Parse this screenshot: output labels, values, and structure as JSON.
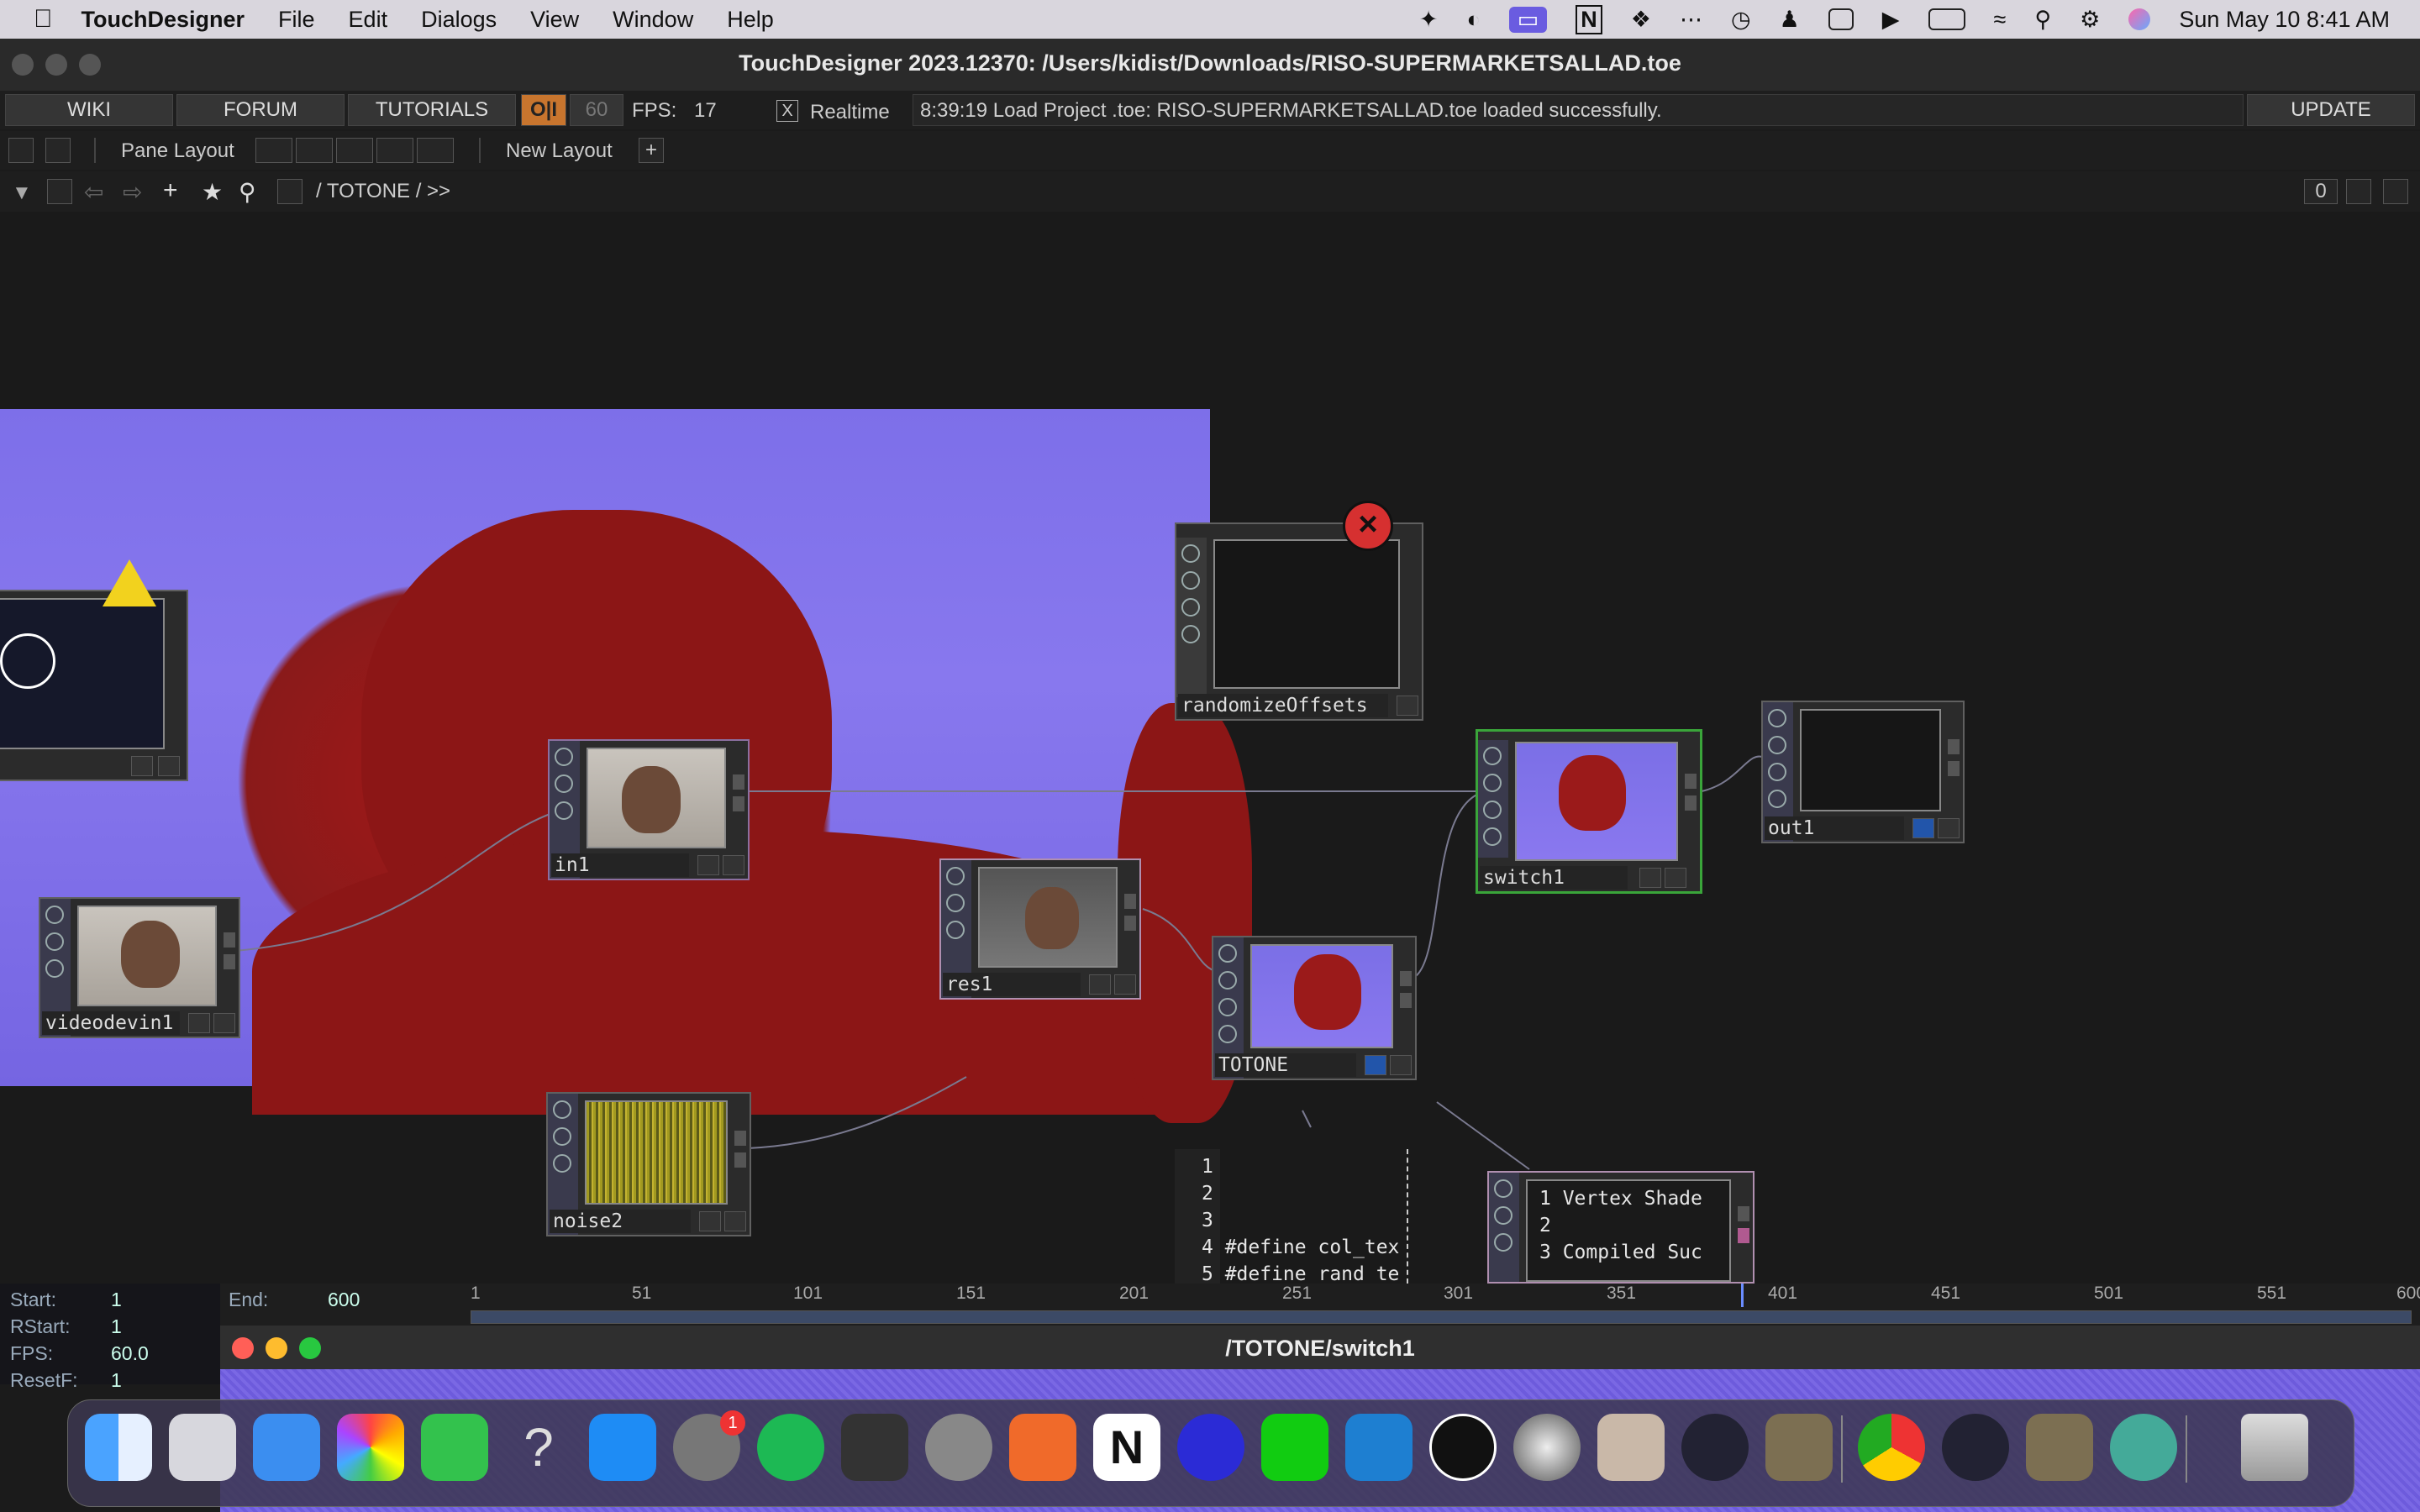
{
  "menubar": {
    "app": "TouchDesigner",
    "items": [
      "File",
      "Edit",
      "Dialogs",
      "View",
      "Window",
      "Help"
    ],
    "datetime": "Sun May 10  8:41 AM",
    "status_icons": [
      "sparkle-icon",
      "browser-icon",
      "screen-mirror-icon",
      "notion-icon",
      "dropbox-icon",
      "more-icon",
      "clock-icon",
      "accessibility-icon",
      "caption-icon",
      "play-icon",
      "battery-icon",
      "wifi-icon",
      "search-icon",
      "control-center-icon",
      "siri-icon"
    ]
  },
  "window": {
    "title": "TouchDesigner 2023.12370: /Users/kidist/Downloads/RISO-SUPERMARKETSALLAD.toe"
  },
  "toolbar1": {
    "wiki": "WIKI",
    "forum": "FORUM",
    "tutorials": "TUTORIALS",
    "oi": "O|I",
    "fps_cap": "60",
    "fps_label": "FPS:",
    "fps_value": "17",
    "realtime_check": "X",
    "realtime": "Realtime",
    "status_message": "8:39:19 Load Project .toe: RISO-SUPERMARKETSALLAD.toe loaded successfully.",
    "update": "UPDATE"
  },
  "toolbar2": {
    "pane_layout": "Pane Layout",
    "new_layout": "New Layout",
    "plus": "+"
  },
  "toolbar3": {
    "path": "/ TOTONE / >>",
    "counter": "0"
  },
  "nodes": {
    "in1": "in1",
    "videodevin1": "videodevin1",
    "res1": "res1",
    "noise2": "noise2",
    "totone": "TOTONE",
    "switch1": "switch1",
    "out1": "out1",
    "randomize": "randomizeOffsets"
  },
  "code_lines": {
    "left": [
      "1",
      "2",
      "3",
      "4 #define col_tex",
      "5 #define rand_te"
    ],
    "right": [
      "1 Vertex Shade",
      "2",
      "3 Compiled Suc"
    ]
  },
  "timeline": {
    "start_label": "Start:",
    "start": "1",
    "end_label": "End:",
    "end": "600",
    "rstart_label": "RStart:",
    "rstart": "1",
    "fps_label": "FPS:",
    "fps": "60.0",
    "resetf_label": "ResetF:",
    "resetf": "1",
    "ticks": [
      "1",
      "51",
      "101",
      "151",
      "201",
      "251",
      "301",
      "351",
      "401",
      "451",
      "501",
      "551",
      "600"
    ]
  },
  "window2": {
    "title": "/TOTONE/switch1"
  },
  "dock": {
    "apps": [
      "finder",
      "launchpad",
      "mail",
      "photos",
      "facetime",
      "help",
      "app-store",
      "system-settings",
      "spotify",
      "final-cut",
      "compressor",
      "obs-record",
      "notion",
      "audacity",
      "pycharm",
      "vscode",
      "touchdesigner",
      "motion",
      "iphone-mirror",
      "obs",
      "app-a",
      "chrome",
      "obs-2",
      "app-b",
      "atom",
      "trash"
    ],
    "badge": "1"
  },
  "colors": {
    "accent_purple": "#7d6fe9",
    "riso_red": "#8a1a1a",
    "selection_green": "#2c8a2c",
    "error_red": "#d63030"
  }
}
